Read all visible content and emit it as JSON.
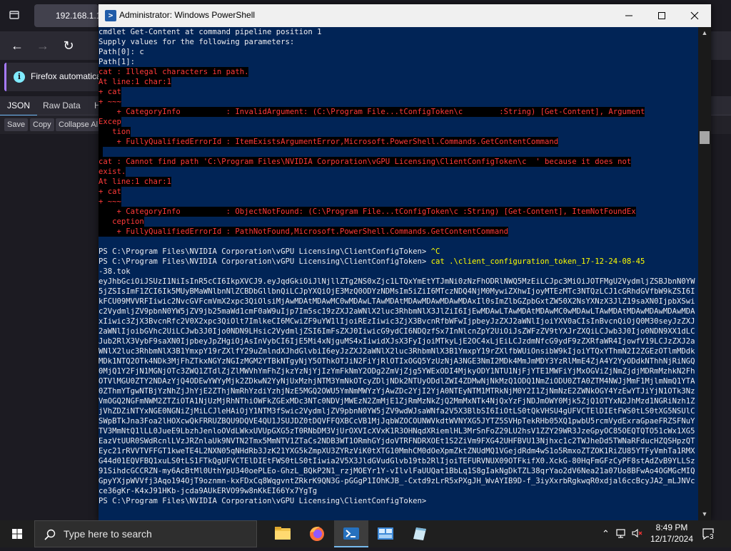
{
  "browser": {
    "tab_title": "192.168.1.1:",
    "notification_text": "Firefox automatica",
    "json_tabs": [
      "JSON",
      "Raw Data",
      "H"
    ],
    "json_tools": [
      "Save",
      "Copy",
      "Collapse Al"
    ]
  },
  "powershell": {
    "title": "Administrator: Windows PowerShell",
    "lines": [
      {
        "text": "cmdlet Get-Content at command pipeline position 1",
        "style": "normal"
      },
      {
        "text": "Supply values for the following parameters:",
        "style": "normal"
      },
      {
        "text": "Path[0]: c",
        "style": "normal"
      },
      {
        "text": "Path[1]:",
        "style": "normal"
      },
      {
        "text": "cat : Illegal characters in path.",
        "style": "err"
      },
      {
        "text": "At line:1 char:1",
        "style": "err"
      },
      {
        "text": "+ cat",
        "style": "err"
      },
      {
        "text": "+ ~~~",
        "style": "err"
      },
      {
        "text": "    + CategoryInfo          : InvalidArgument: (C:\\Program File...tConfigToken\\c        :String) [Get-Content], Argument",
        "style": "err"
      },
      {
        "text": "Excep",
        "style": "err"
      },
      {
        "text": "   tion",
        "style": "err"
      },
      {
        "text": "    + FullyQualifiedErrorId : ItemExistsArgumentError,Microsoft.PowerShell.Commands.GetContentCommand",
        "style": "err"
      },
      {
        "text": "",
        "style": "errbar"
      },
      {
        "text": "cat : Cannot find path 'C:\\Program Files\\NVIDIA Corporation\\vGPU Licensing\\ClientConfigToken\\c  ' because it does not",
        "style": "err"
      },
      {
        "text": "exist.",
        "style": "err"
      },
      {
        "text": "At line:1 char:1",
        "style": "err"
      },
      {
        "text": "+ cat",
        "style": "err"
      },
      {
        "text": "+ ~~~",
        "style": "err"
      },
      {
        "text": "    + CategoryInfo          : ObjectNotFound: (C:\\Program File...tConfigToken\\c :String) [Get-Content], ItemNotFoundEx",
        "style": "err"
      },
      {
        "text": "   ception",
        "style": "err"
      },
      {
        "text": "    + FullyQualifiedErrorId : PathNotFound,Microsoft.PowerShell.Commands.GetContentCommand",
        "style": "err"
      },
      {
        "text": "",
        "style": "normal"
      },
      {
        "text": "PS C:\\Program Files\\NVIDIA Corporation\\vGPU Licensing\\ClientConfigToken> ^C",
        "style": "prompt_ctrl"
      },
      {
        "text": "PS C:\\Program Files\\NVIDIA Corporation\\vGPU Licensing\\ClientConfigToken> cat .\\client_configuration_token_17-12-24-08-45",
        "style": "prompt_cmd"
      },
      {
        "text": "-38.tok",
        "style": "normal"
      }
    ],
    "token": "eyJhbGciOiJSUzI1NiIsInR5cCI6IkpXVCJ9.eyJqdGkiOiJlNjllZTg2NS0xZjc1LTQxYmEtYTJmNi0zNzFhODRlNWQ5MzEiLCJpc3MiOiJOTFMgU2VydmljZSBJbnN0YW5jZSIsImF1ZCI6Ik5MUyBMaWNlbnNlZCBDbGllbnQiLCJpYXQiOjE3MzQ0ODYzNDMsIm5iZiI6MTczNDQ4NjM0MywiZXhwIjoyMTEzMTc3NTQzLCJ1cGRhdGVfbW9kZSI6IkFCU09MVVRFIiwic2NvcGVFcmVmX2xpc3QiOlsiMjAwMDAtMDAwMC0wMDAwLTAwMDAtMDAwMDAwMDAwMDAxIl0sImZlbGZpbGxtZW50X2NsYXNzX3JlZ19saXN0IjpbXSwic2VydmljZV9pbnN0YW5jZV9jb25maWd1cmF0aW9uIjp7Im5sc19zZXJ2aWNlX2luc3RhbmNlX3JlZiI6IjEwMDAwLTAwMDAtMDAwMC0wMDAwLTAwMDAtMDAwMDAwMDAwMDAxIiwic3ZjX3BvcnRfc2V0X2xpc3QiOlt7ImlkeCI6MCwiZF9uYW1lIjoiREzIiwic3ZjX3BvcnRfbWFwIjpbeyJzZXJ2aWNlIjoiYXV0aCIsInBvcnQiOjQ0M30seyJzZXJ2aWNlIjoibGVhc2UiLCJwb3J0Ijo0NDN9LHsic2VydmljZSI6ImFsZXJ0IiwicG9ydCI6NDQzfSx7InNlcnZpY2UiOiJsZWFzZV9tYXJrZXQiLCJwb3J0Ijo0NDN9XX1dLCJub2RlX3VybF9saXN0IjpbeyJpZHgiOjAsInVybCI6IjE5Mi4xNjguMS4xIiwidXJsX3FyIjoiMTkyLjE2OC4xLjEiLCJzdmNfcG9ydF9zZXRfaWR4IjowfV19LCJzZXJ2aWNlX2luc3RhbmNlX3B1YmxpY19rZXlfY29uZmlndXJhdGlvbiI6eyJzZXJ2aWNlX2luc3RhbmNlX3B1YmxpY19rZXlfbWUiOnsibW9kIjoiYTQxYThmN2I2ZGEzOTlmMDdkMDk1NTQ2OTk4NDk3MjFhZTkxNGYzNGIzMGM2YTBkNTgyNjY5OThkOTJiN2FiYjRlOTIxOGQ5YzUzNjA3NGE3NmI2MDk4MmJmMDY3YzRlMmE4ZjA4Y2YyODdkNThhNjRiNGQ0MjQ1Y2FjN1MGNjOTc3ZWQ1ZTdlZjZlMWVhYmFhZjkzYzNjYjIzYmFkNmY2ODg2ZmVjZjg5YWExODI4MjkyODY1NTU1NjFjYTE1MWFiYjMxOGViZjNmZjdjMDRmMzhkN2FhOTVlMGU0ZTY2NDAzYjQ4ODEwYWYyMjk2ZDkwN2YyNjUxMzhjNTM3YmNkOTcyZDljNDk2NTUyODdlZWI4ZDMwNjNkMzQ1ODQ1NmZiODU0ZTA0ZTM4NWJjMmF1MjlmNmQ1YTA0ZThmYTgwNTBjYzNhZjJhYjE2ZThjNmRhYzdiYzhjNzE5MGQ2OWU5YmNmMWYzYjAwZDc2YjI2YjA0NTEyNTM1MTRkNjM0Y2I1ZjNmNzE2ZWNkOGY4YzEwYTJiYjN1OTk3NzVmOGQ2NGFmNWM2ZTZiOTA1NjUzMjRhNThiOWFkZGExMDc3NTc0NDVjMWEzN2ZmMjE1ZjRmMzNkZjQ2MmMxNTk4NjQxYzFjNDJmOWY0Mjk5ZjQ1OTYxN2JhMzd1NGRiNzh1ZjVhZDZiNTYxNGE0NGNiZjMiLCJleHAiOjY1NTM3fSwic2VydmljZV9pbnN0YW5jZV9wdWJsaWNfa2V5X3BlbSI6IiOtLS0tQkVHSU4gUFVCTElDIEtFWS0tLS0tXG5NSUlCSWpBTkJna3Foa2lHOXcwQkFRRUZBQU9DQVE4QU1JSUJDZ0tDQVFFQXBCcVB1MjJqbWZOCOUNWVkdtWVNYXG5JYTZ5SVHpTekRHb05XQ1pwbU5rcmVydExraGpaeFRZSFNuYTV3MmNtQ1lLL0JueE9LbzhJenloOVdLWkxUVUpGXG5zT0RNbDM3VjUrOXVIcXVxK1R3OHNqdXRiemlHL3MrSnFoZ29LU2hsV1ZZY29WR3JzeGpyOC85OEQTQTO51cWx1XG5EazVtUUR0SWdRcnlLVzJRZnlaUk9NVTN2Tmx5MmNTV1ZTaCs2NDB3WT1ORmhGYjdoVTRFNDRXOEt1S2ZiVm9FXG42UHFBVU13Njhxc1c2TWJheDd5TWNaRFducHZQSHpzQTEyc21rRVVTVFFGT1kweTE4L2NXN05qNHdRb3JzK21YXG5kZmpXU3ZYRzViK0tXTG10MmhCM0dOeXpmZktZNUdMQ1VGejdRdm4wS1o5RmxoZTZOK1RiZU85YTFyVmhTa1RMXG44d01EQVFBQ1xuLS0tLS1FTkQgUFVCTElDIEtFWS0tLS0tIiwia2V5X3JldGVudGlvb19tb2RlIjoiTEFURVNUX09OTFkifX0.XckG-80HqFmGFzCyPF8stAdZvB9YLLSz91SihdcGCCRZN-my6AcBtMl0UthYpU340oePLEo-GhzL_BQkP2N1_rzjMOEYr1Y-vIlvlFaUUQat1BbLq1S8gIakNgDkTZL38qrYao2dV6Nea21a07Uo8BFwAo4OGMGcMIQGpyYXjpWVVfj3Aqo194OjT9oznmn-kxFDxCq8WqgvntZRkrK9QN3G-pGGgP1IOhKJB_-Cxtd9zLrR5xPXgJH_WvAYIB9D-f_3iyXxrbRgkwqR0xdjal6ccBcyJA2_mLJNVcce36gKr-K4xJ91HKb-jcda9AUkERVO99w8nKkEI66Yx7YgTg",
    "final_prompt": "PS C:\\Program Files\\NVIDIA Corporation\\vGPU Licensing\\ClientConfigToken>"
  },
  "taskbar": {
    "search_placeholder": "Type here to search",
    "time": "8:49 PM",
    "date": "12/17/2024",
    "notification_count": "3"
  }
}
